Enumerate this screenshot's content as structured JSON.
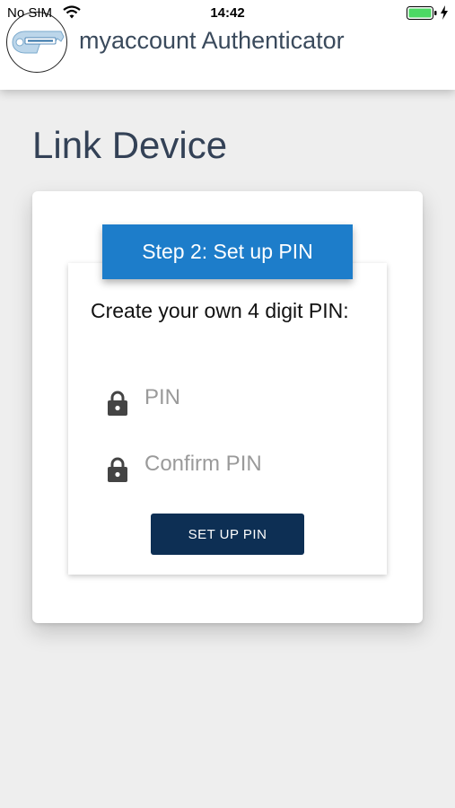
{
  "status_bar": {
    "carrier": "No SIM",
    "time": "14:42",
    "wifi_icon": "wifi-icon",
    "battery_icon": "battery-icon",
    "charging_icon": "charging-bolt-icon",
    "battery_color": "#4cd964"
  },
  "header": {
    "logo_icon": "authenticator-key-logo",
    "title": "myaccount Authenticator"
  },
  "page": {
    "title": "Link Device"
  },
  "card": {
    "step_label": "Step 2: Set up PIN",
    "instruction": "Create your own 4 digit PIN:",
    "pin_placeholder": "PIN",
    "confirm_placeholder": "Confirm PIN",
    "pin_value": "",
    "confirm_value": "",
    "field_icon": "lock-icon",
    "button_label": "SET UP PIN"
  },
  "colors": {
    "step_banner": "#1d7dca",
    "button": "#0d2f54",
    "title_text": "#334156",
    "background": "#eeeeee"
  }
}
